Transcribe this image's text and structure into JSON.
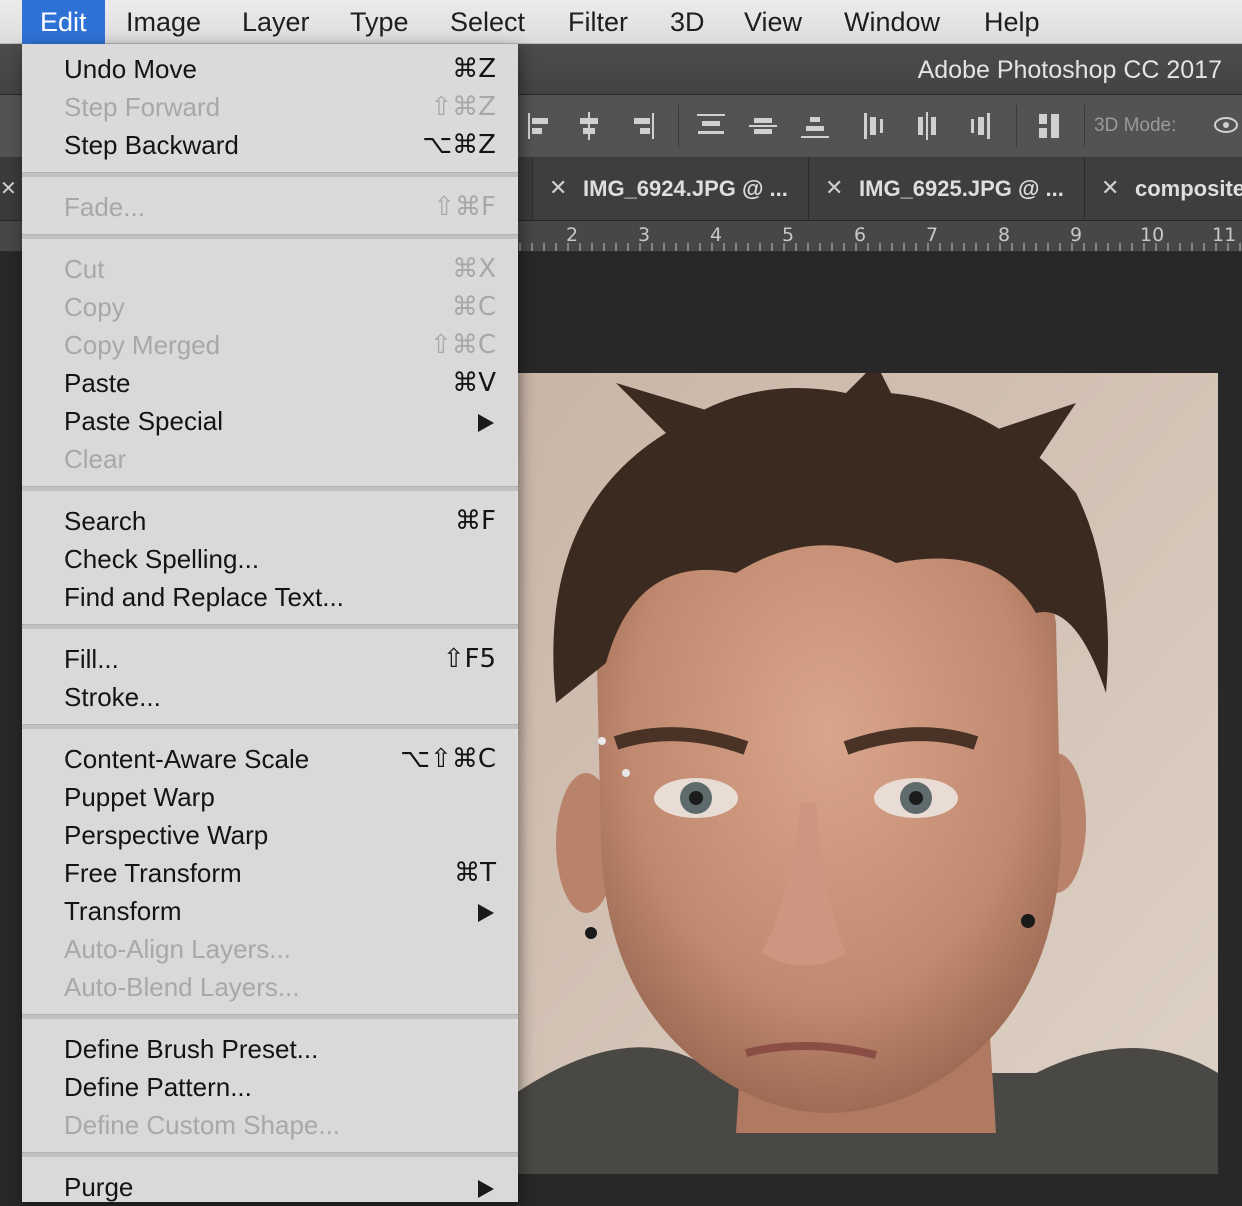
{
  "menubar": {
    "items": [
      {
        "label": "Edit"
      },
      {
        "label": "Image"
      },
      {
        "label": "Layer"
      },
      {
        "label": "Type"
      },
      {
        "label": "Select"
      },
      {
        "label": "Filter"
      },
      {
        "label": "3D"
      },
      {
        "label": "View"
      },
      {
        "label": "Window"
      },
      {
        "label": "Help"
      }
    ],
    "active": "Edit"
  },
  "window": {
    "title": "Adobe Photoshop CC 2017"
  },
  "options_bar": {
    "mode_label": "3D Mode:"
  },
  "tabs": [
    {
      "label": "IMG_6924.JPG @ ..."
    },
    {
      "label": "IMG_6925.JPG @ ..."
    },
    {
      "label": "composite"
    }
  ],
  "ruler": {
    "numbers": [
      "2",
      "3",
      "4",
      "5",
      "6",
      "7",
      "8",
      "9",
      "10",
      "11"
    ]
  },
  "canvas": {
    "image": "portrait photo of a person with short dark spiky hair, eyebrow piercing, dark hoodie"
  },
  "edit_menu": {
    "groups": [
      [
        {
          "label": "Undo Move",
          "shortcut": "⌘Z",
          "enabled": true
        },
        {
          "label": "Step Forward",
          "shortcut": "⇧⌘Z",
          "enabled": false
        },
        {
          "label": "Step Backward",
          "shortcut": "⌥⌘Z",
          "enabled": true
        }
      ],
      [
        {
          "label": "Fade...",
          "shortcut": "⇧⌘F",
          "enabled": false
        }
      ],
      [
        {
          "label": "Cut",
          "shortcut": "⌘X",
          "enabled": false
        },
        {
          "label": "Copy",
          "shortcut": "⌘C",
          "enabled": false
        },
        {
          "label": "Copy Merged",
          "shortcut": "⇧⌘C",
          "enabled": false
        },
        {
          "label": "Paste",
          "shortcut": "⌘V",
          "enabled": true
        },
        {
          "label": "Paste Special",
          "shortcut": "",
          "submenu": true,
          "enabled": true
        },
        {
          "label": "Clear",
          "shortcut": "",
          "enabled": false
        }
      ],
      [
        {
          "label": "Search",
          "shortcut": "⌘F",
          "enabled": true
        },
        {
          "label": "Check Spelling...",
          "shortcut": "",
          "enabled": true
        },
        {
          "label": "Find and Replace Text...",
          "shortcut": "",
          "enabled": true
        }
      ],
      [
        {
          "label": "Fill...",
          "shortcut": "⇧F5",
          "enabled": true
        },
        {
          "label": "Stroke...",
          "shortcut": "",
          "enabled": true
        }
      ],
      [
        {
          "label": "Content-Aware Scale",
          "shortcut": "⌥⇧⌘C",
          "enabled": true
        },
        {
          "label": "Puppet Warp",
          "shortcut": "",
          "enabled": true
        },
        {
          "label": "Perspective Warp",
          "shortcut": "",
          "enabled": true
        },
        {
          "label": "Free Transform",
          "shortcut": "⌘T",
          "enabled": true
        },
        {
          "label": "Transform",
          "shortcut": "",
          "submenu": true,
          "enabled": true
        },
        {
          "label": "Auto-Align Layers...",
          "shortcut": "",
          "enabled": false
        },
        {
          "label": "Auto-Blend Layers...",
          "shortcut": "",
          "enabled": false
        }
      ],
      [
        {
          "label": "Define Brush Preset...",
          "shortcut": "",
          "enabled": true
        },
        {
          "label": "Define Pattern...",
          "shortcut": "",
          "enabled": true
        },
        {
          "label": "Define Custom Shape...",
          "shortcut": "",
          "enabled": false
        }
      ],
      [
        {
          "label": "Purge",
          "shortcut": "",
          "submenu": true,
          "enabled": true
        }
      ]
    ]
  }
}
